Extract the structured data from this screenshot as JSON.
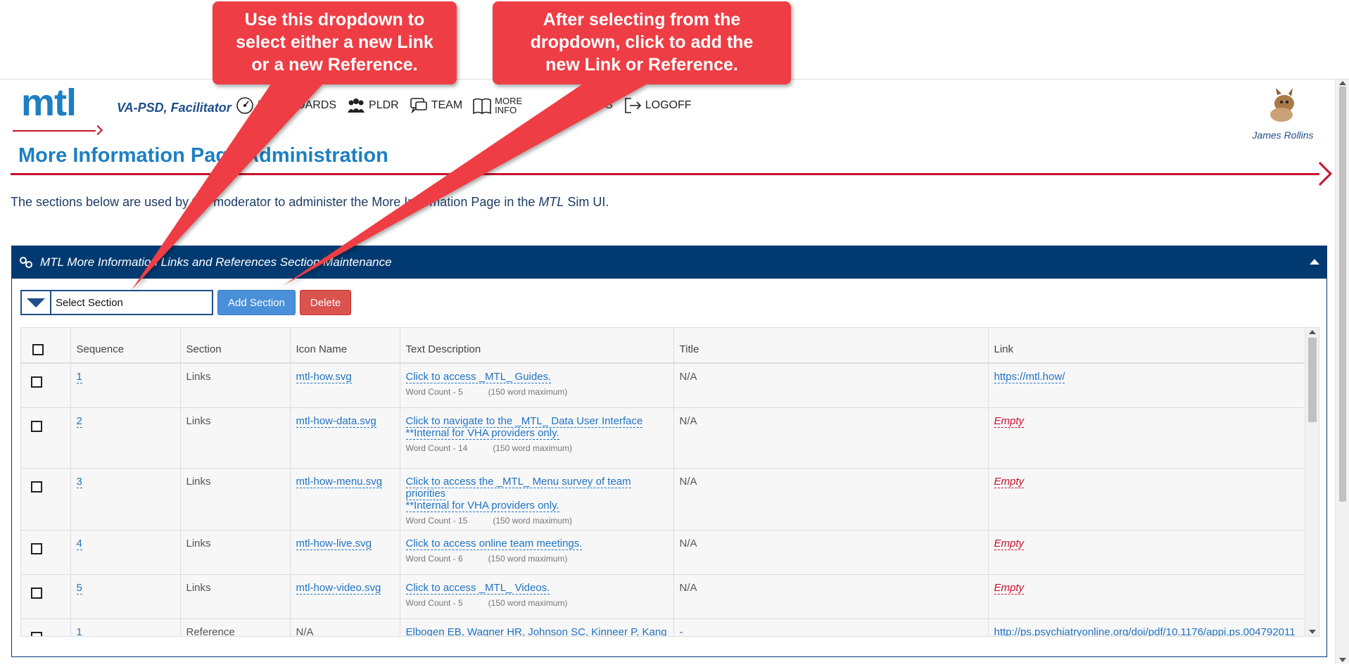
{
  "app": {
    "role": "VA-PSD, Facilitator",
    "logo": "mtl"
  },
  "nav": [
    {
      "icon": "dashboard-icon",
      "label": "DASHBOARDS"
    },
    {
      "icon": "team-members-icon",
      "label": "PLDR"
    },
    {
      "icon": "chat-icon",
      "label": "TEAM"
    },
    {
      "icon": "book-icon",
      "label_line1": "MORE",
      "label_line2": "INFO"
    },
    {
      "icon": "glasses-icon",
      "label": "TIPS"
    },
    {
      "icon": "logoff-icon",
      "label": "LOGOFF"
    }
  ],
  "user": {
    "name": "James Rollins"
  },
  "page": {
    "title": "More Information Page Administration",
    "intro_prefix": "The sections below are used by the moderator to administer the More Information Page in the ",
    "intro_brand": "MTL",
    "intro_suffix": " Sim UI."
  },
  "panel": {
    "title": "MTL More Information Links and References Section Maintenance",
    "select_value": "Select Section",
    "add_label": "Add Section",
    "delete_label": "Delete"
  },
  "table": {
    "headers": [
      "Sequence",
      "Section",
      "Icon Name",
      "Text Description",
      "Title",
      "Link"
    ],
    "word_count_label": "Word Count -",
    "word_max_label": "(150 word maximum)",
    "rows": [
      {
        "seq": "1",
        "section": "Links",
        "icon": "mtl-how.svg",
        "text1": "Click to access _MTL_ Guides.",
        "text2": "",
        "wc": "5",
        "title": "N/A",
        "link": "https://mtl.how/",
        "link_empty": false
      },
      {
        "seq": "2",
        "section": "Links",
        "icon": "mtl-how-data.svg",
        "text1": "Click to navigate to the _MTL_ Data User Interface",
        "text2": "**Internal for VHA providers only.",
        "wc": "14",
        "title": "N/A",
        "link": "Empty",
        "link_empty": true
      },
      {
        "seq": "3",
        "section": "Links",
        "icon": "mtl-how-menu.svg",
        "text1": "Click to access the _MTL_ Menu survey of team priorities",
        "text2": "**Internal for VHA providers only.",
        "wc": "15",
        "title": "N/A",
        "link": "Empty",
        "link_empty": true
      },
      {
        "seq": "4",
        "section": "Links",
        "icon": "mtl-how-live.svg",
        "text1": "Click to access online team meetings.",
        "text2": "",
        "wc": "6",
        "title": "N/A",
        "link": "Empty",
        "link_empty": true
      },
      {
        "seq": "5",
        "section": "Links",
        "icon": "mtl-how-video.svg",
        "text1": "Click to access _MTL_ Videos.",
        "text2": "",
        "wc": "5",
        "title": "N/A",
        "link": "Empty",
        "link_empty": true
      },
      {
        "seq": "1",
        "section": "Reference",
        "icon": "N/A",
        "text1": "Elbogen EB, Wagner HR, Johnson SC, Kinneer P, Kang H,",
        "text2": "",
        "wc": "",
        "title": "-",
        "link": "http://ps.psychiatryonline.org/doi/pdf/10.1176/appi.ps.004792011",
        "link_empty": false
      }
    ]
  },
  "callouts": [
    {
      "line1": "Use this dropdown to",
      "line2": "select either a new Link",
      "line3": "or a new Reference."
    },
    {
      "line1": "After selecting from the",
      "line2": "dropdown, click to add the",
      "line3": "new Link or Reference."
    }
  ],
  "colors": {
    "accent_blue": "#1d7fc3",
    "panel_navy": "#003a70",
    "brand_red": "#c8102e",
    "callout_red": "#ee3e45"
  }
}
